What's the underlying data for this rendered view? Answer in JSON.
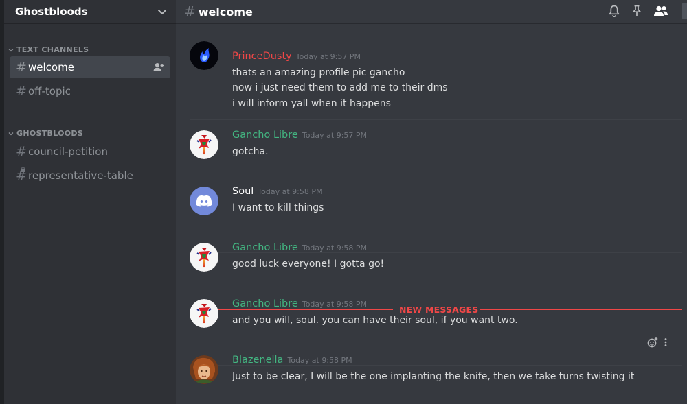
{
  "guild": {
    "name": "Ghostbloods"
  },
  "sidebar": {
    "categories": [
      {
        "label": "TEXT CHANNELS",
        "channels": [
          {
            "name": "welcome"
          },
          {
            "name": "off-topic"
          }
        ]
      },
      {
        "label": "GHOSTBLOODS",
        "channels": [
          {
            "name": "council-petition"
          },
          {
            "name": "representative-table"
          }
        ]
      }
    ]
  },
  "header": {
    "channel": "welcome"
  },
  "new_messages_label": "NEW MESSAGES",
  "colors": {
    "red_user": "#f04747",
    "green_user": "#43b581",
    "white_user": "#ffffff",
    "discord_blurple": "#7289da",
    "new_messages": "#f04747"
  },
  "messages": [
    {
      "author": "PrinceDusty",
      "author_color": "#f04747",
      "timestamp": "Today at 9:57 PM",
      "avatar": "blue-flame-avatar",
      "lines": [
        "thats an amazing profile pic gancho",
        "now i just need them to add me to their dms",
        "i will inform yall when it happens"
      ]
    },
    {
      "author": "Gancho Libre",
      "author_color": "#43b581",
      "timestamp": "Today at 9:57 PM",
      "avatar": "red-figure-avatar",
      "lines": [
        "gotcha."
      ]
    },
    {
      "author": "Soul",
      "author_color": "#ffffff",
      "timestamp": "Today at 9:58 PM",
      "avatar": "discord-default-avatar",
      "lines": [
        "I want to kill things"
      ]
    },
    {
      "author": "Gancho Libre",
      "author_color": "#43b581",
      "timestamp": "Today at 9:58 PM",
      "avatar": "red-figure-avatar",
      "lines": [
        "good luck everyone! I gotta go!"
      ]
    },
    {
      "author": "Gancho Libre",
      "author_color": "#43b581",
      "timestamp": "Today at 9:58 PM",
      "avatar": "red-figure-avatar",
      "lines": [
        "and you will, soul. you can have their soul, if you want two."
      ]
    },
    {
      "author": "Blazenella",
      "author_color": "#43b581",
      "timestamp": "Today at 9:58 PM",
      "avatar": "portrait-avatar",
      "lines": [
        "Just to be clear, I will be the one implanting the knife, then we take turns twisting it"
      ]
    }
  ]
}
